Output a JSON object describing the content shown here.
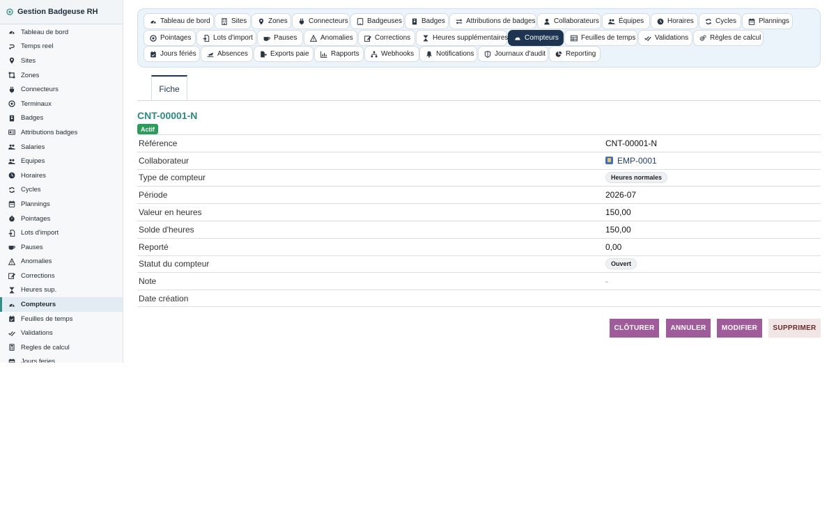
{
  "app": {
    "title": "Gestion Badgeuse RH",
    "logo_icon": "wifi-icon"
  },
  "sidebar": {
    "items": [
      {
        "label": "Tableau de bord",
        "icon": "gauge"
      },
      {
        "label": "Temps reel",
        "icon": "stream"
      },
      {
        "label": "Sites",
        "icon": "pin"
      },
      {
        "label": "Zones",
        "icon": "zones"
      },
      {
        "label": "Connecteurs",
        "icon": "plug"
      },
      {
        "label": "Terminaux",
        "icon": "wifi"
      },
      {
        "label": "Badges",
        "icon": "badge"
      },
      {
        "label": "Attributions badges",
        "icon": "idcard"
      },
      {
        "label": "Salaries",
        "icon": "users"
      },
      {
        "label": "Equipes",
        "icon": "users"
      },
      {
        "label": "Horaires",
        "icon": "clock"
      },
      {
        "label": "Cycles",
        "icon": "sync"
      },
      {
        "label": "Plannings",
        "icon": "calendar"
      },
      {
        "label": "Pointages",
        "icon": "stopwatch"
      },
      {
        "label": "Lots d'import",
        "icon": "fileimport"
      },
      {
        "label": "Pauses",
        "icon": "coffee"
      },
      {
        "label": "Anomalies",
        "icon": "warning"
      },
      {
        "label": "Corrections",
        "icon": "edit"
      },
      {
        "label": "Heures sup.",
        "icon": "hourglass"
      },
      {
        "label": "Compteurs",
        "icon": "gauge",
        "active": true
      },
      {
        "label": "Feuilles de temps",
        "icon": "calcheck"
      },
      {
        "label": "Validations",
        "icon": "checks"
      },
      {
        "label": "Regles de calcul",
        "icon": "calculator"
      },
      {
        "label": "Jours feries",
        "icon": "calendar"
      }
    ]
  },
  "tabs": [
    {
      "label": "Tableau de bord",
      "icon": "gauge"
    },
    {
      "label": "Sites",
      "icon": "building"
    },
    {
      "label": "Zones",
      "icon": "pin"
    },
    {
      "label": "Connecteurs",
      "icon": "plug"
    },
    {
      "label": "Badgeuses",
      "icon": "tablet"
    },
    {
      "label": "Badges",
      "icon": "badge"
    },
    {
      "label": "Attributions de badges",
      "icon": "exchange"
    },
    {
      "label": "Collaborateurs",
      "icon": "user"
    },
    {
      "label": "Équipes",
      "icon": "users"
    },
    {
      "label": "Horaires",
      "icon": "clock"
    },
    {
      "label": "Cycles",
      "icon": "sync"
    },
    {
      "label": "Plannings",
      "icon": "calendar"
    },
    {
      "label": "Pointages",
      "icon": "wifi"
    },
    {
      "label": "Lots d'import",
      "icon": "fileimport"
    },
    {
      "label": "Pauses",
      "icon": "coffee"
    },
    {
      "label": "Anomalies",
      "icon": "warning"
    },
    {
      "label": "Corrections",
      "icon": "edit"
    },
    {
      "label": "Heures supplémentaires",
      "icon": "hourglass"
    },
    {
      "label": "Compteurs",
      "icon": "gauge",
      "active": true
    },
    {
      "label": "Feuilles de temps",
      "icon": "table"
    },
    {
      "label": "Validations",
      "icon": "checks"
    },
    {
      "label": "Règles de calcul",
      "icon": "cogs"
    },
    {
      "label": "Jours fériés",
      "icon": "calcheck"
    },
    {
      "label": "Absences",
      "icon": "plane"
    },
    {
      "label": "Exports paie",
      "icon": "fileexport"
    },
    {
      "label": "Rapports",
      "icon": "chart"
    },
    {
      "label": "Webhooks",
      "icon": "network"
    },
    {
      "label": "Notifications",
      "icon": "bell"
    },
    {
      "label": "Journaux d'audit",
      "icon": "shield"
    },
    {
      "label": "Reporting",
      "icon": "piechart"
    }
  ],
  "subtab": {
    "label": "Fiche"
  },
  "record": {
    "title": "CNT-00001-N",
    "status": "Actif",
    "fields": [
      {
        "label": "Référence",
        "value": "CNT-00001-N",
        "kind": "text"
      },
      {
        "label": "Collaborateur",
        "value": "EMP-0001",
        "kind": "link"
      },
      {
        "label": "Type de compteur",
        "value": "Heures normales",
        "kind": "pill"
      },
      {
        "label": "Période",
        "value": "2026-07",
        "kind": "text"
      },
      {
        "label": "Valeur en heures",
        "value": "150,00",
        "kind": "text"
      },
      {
        "label": "Solde d'heures",
        "value": "150,00",
        "kind": "text"
      },
      {
        "label": "Reporté",
        "value": "0,00",
        "kind": "text"
      },
      {
        "label": "Statut du compteur",
        "value": "Ouvert",
        "kind": "pill"
      },
      {
        "label": "Note",
        "value": "-",
        "kind": "muted"
      },
      {
        "label": "Date création",
        "value": "",
        "kind": "text"
      }
    ]
  },
  "actions": {
    "close": "CLÔTURER",
    "cancel": "ANNULER",
    "edit": "MODIFIER",
    "delete": "SUPPRIMER"
  },
  "colors": {
    "accent": "#2a8c80",
    "active_tab": "#1d3550",
    "status_green": "#2a9d5a",
    "action_purple": "#a05c9a"
  }
}
